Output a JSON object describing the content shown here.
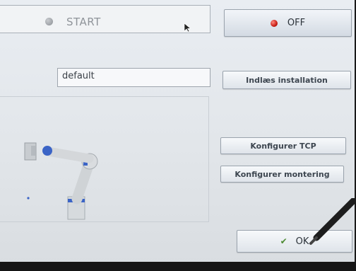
{
  "status": {
    "label": "START"
  },
  "power": {
    "label": "OFF",
    "state_color": "#c81e14"
  },
  "installation": {
    "name": "default",
    "load_button": "Indlæs installation"
  },
  "actions": {
    "configure_tcp": "Konfigurer TCP",
    "configure_mounting": "Konfigurer montering"
  },
  "footer": {
    "ok_label": "OK"
  },
  "icons": [
    "status-dot-icon",
    "cursor-icon",
    "power-led-icon",
    "robot-arm-icon",
    "check-icon"
  ]
}
